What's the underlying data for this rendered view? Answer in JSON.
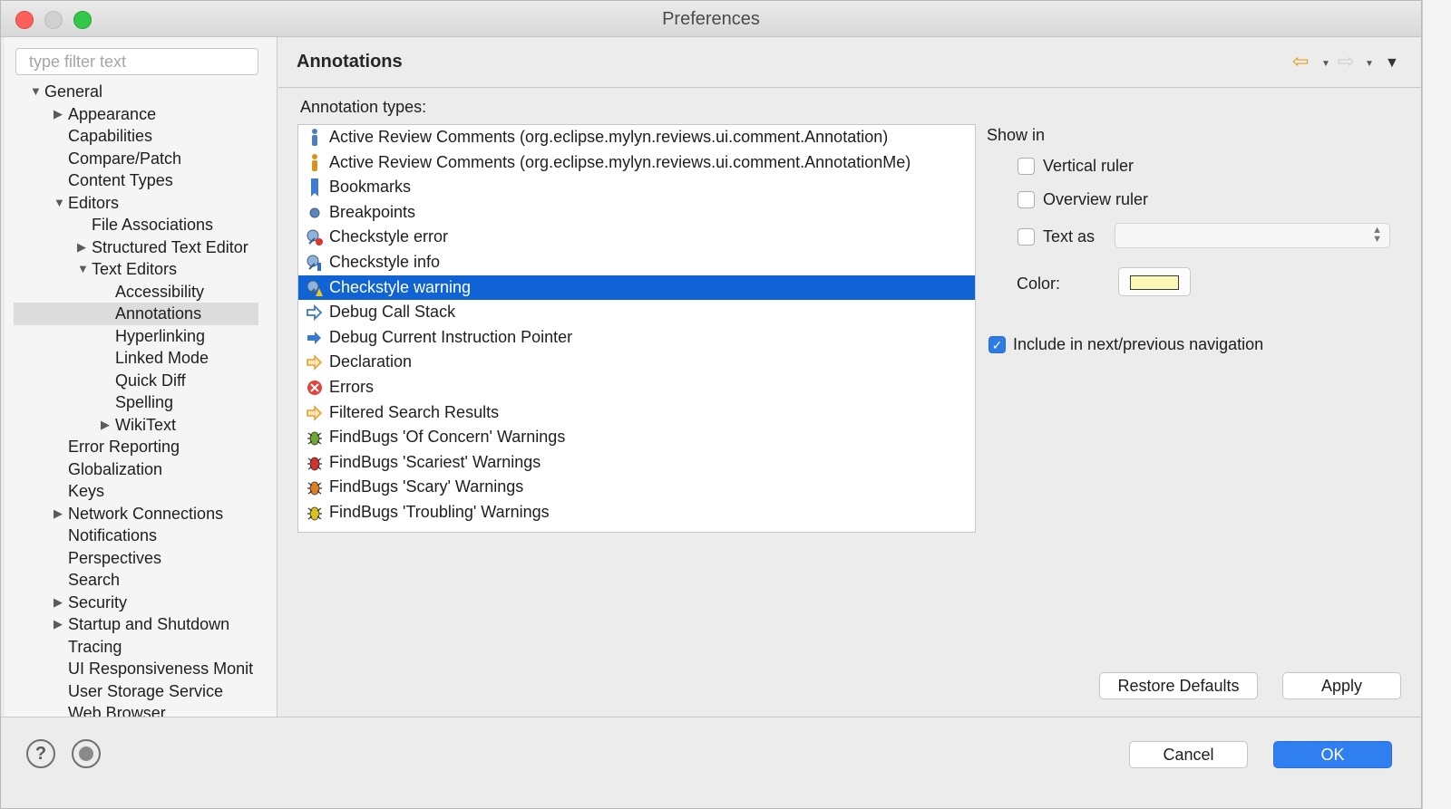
{
  "window": {
    "title": "Preferences"
  },
  "filter": {
    "placeholder": "type filter text"
  },
  "tree": [
    {
      "label": "General",
      "level": 0,
      "arrow": "expanded"
    },
    {
      "label": "Appearance",
      "level": 1,
      "arrow": "collapsed"
    },
    {
      "label": "Capabilities",
      "level": 1,
      "arrow": "none"
    },
    {
      "label": "Compare/Patch",
      "level": 1,
      "arrow": "none"
    },
    {
      "label": "Content Types",
      "level": 1,
      "arrow": "none"
    },
    {
      "label": "Editors",
      "level": 1,
      "arrow": "expanded"
    },
    {
      "label": "File Associations",
      "level": 2,
      "arrow": "none"
    },
    {
      "label": "Structured Text Editor",
      "level": 2,
      "arrow": "collapsed"
    },
    {
      "label": "Text Editors",
      "level": 2,
      "arrow": "expanded"
    },
    {
      "label": "Accessibility",
      "level": 3,
      "arrow": "none"
    },
    {
      "label": "Annotations",
      "level": 3,
      "arrow": "none",
      "selected": true
    },
    {
      "label": "Hyperlinking",
      "level": 3,
      "arrow": "none"
    },
    {
      "label": "Linked Mode",
      "level": 3,
      "arrow": "none"
    },
    {
      "label": "Quick Diff",
      "level": 3,
      "arrow": "none"
    },
    {
      "label": "Spelling",
      "level": 3,
      "arrow": "none"
    },
    {
      "label": "WikiText",
      "level": 3,
      "arrow": "collapsed"
    },
    {
      "label": "Error Reporting",
      "level": 1,
      "arrow": "none"
    },
    {
      "label": "Globalization",
      "level": 1,
      "arrow": "none"
    },
    {
      "label": "Keys",
      "level": 1,
      "arrow": "none"
    },
    {
      "label": "Network Connections",
      "level": 1,
      "arrow": "collapsed"
    },
    {
      "label": "Notifications",
      "level": 1,
      "arrow": "none"
    },
    {
      "label": "Perspectives",
      "level": 1,
      "arrow": "none"
    },
    {
      "label": "Search",
      "level": 1,
      "arrow": "none"
    },
    {
      "label": "Security",
      "level": 1,
      "arrow": "collapsed"
    },
    {
      "label": "Startup and Shutdown",
      "level": 1,
      "arrow": "collapsed"
    },
    {
      "label": "Tracing",
      "level": 1,
      "arrow": "none"
    },
    {
      "label": "UI Responsiveness Monit",
      "level": 1,
      "arrow": "none"
    },
    {
      "label": "User Storage Service",
      "level": 1,
      "arrow": "none"
    },
    {
      "label": "Web Browser",
      "level": 1,
      "arrow": "none"
    }
  ],
  "page": {
    "title": "Annotations"
  },
  "annotation_types": {
    "label": "Annotation types:",
    "items": [
      {
        "label": "Active Review Comments (org.eclipse.mylyn.reviews.ui.comment.Annotation)",
        "icon": "person-blue-icon"
      },
      {
        "label": "Active Review Comments (org.eclipse.mylyn.reviews.ui.comment.AnnotationMe)",
        "icon": "person-orange-icon"
      },
      {
        "label": "Bookmarks",
        "icon": "bookmark-icon"
      },
      {
        "label": "Breakpoints",
        "icon": "breakpoint-icon"
      },
      {
        "label": "Checkstyle error",
        "icon": "checkstyle-error-icon"
      },
      {
        "label": "Checkstyle info",
        "icon": "checkstyle-info-icon"
      },
      {
        "label": "Checkstyle warning",
        "icon": "checkstyle-warning-icon",
        "selected": true
      },
      {
        "label": "Debug Call Stack",
        "icon": "arrow-outline-blue-icon"
      },
      {
        "label": "Debug Current Instruction Pointer",
        "icon": "arrow-solid-blue-icon"
      },
      {
        "label": "Declaration",
        "icon": "arrow-orange-icon"
      },
      {
        "label": "Errors",
        "icon": "error-icon"
      },
      {
        "label": "Filtered Search Results",
        "icon": "arrow-orange-icon"
      },
      {
        "label": "FindBugs 'Of Concern' Warnings",
        "icon": "bug-green-icon"
      },
      {
        "label": "FindBugs 'Scariest' Warnings",
        "icon": "bug-red-icon"
      },
      {
        "label": "FindBugs 'Scary' Warnings",
        "icon": "bug-orange-icon"
      },
      {
        "label": "FindBugs 'Troubling' Warnings",
        "icon": "bug-yellow-icon"
      }
    ]
  },
  "show_in": {
    "label": "Show in",
    "vertical_ruler": {
      "label": "Vertical ruler",
      "checked": false
    },
    "overview_ruler": {
      "label": "Overview ruler",
      "checked": false
    },
    "text_as": {
      "label": "Text as",
      "checked": false,
      "value": ""
    }
  },
  "color": {
    "label": "Color:",
    "value": "#fbf7b4"
  },
  "navigation": {
    "label": "Include in next/previous navigation",
    "checked": true
  },
  "buttons": {
    "restore_defaults": "Restore Defaults",
    "apply": "Apply",
    "cancel": "Cancel",
    "ok": "OK"
  },
  "colors": {
    "selection": "#0f63d4",
    "primary_button": "#2f7ff0",
    "back_arrow": "#e3a01c"
  }
}
